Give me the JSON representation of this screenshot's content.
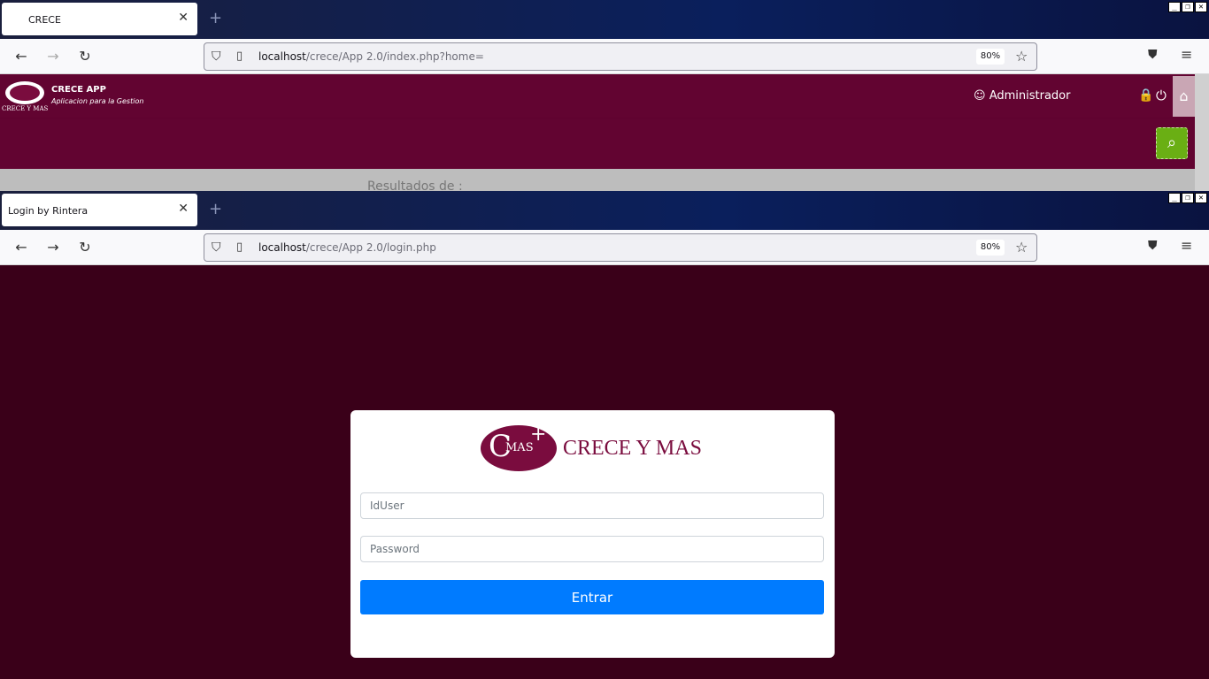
{
  "window1": {
    "tab_title": "CRECE",
    "url_host": "localhost",
    "url_path": "/crece/App 2.0/index.php?home=",
    "zoom": "80%"
  },
  "page1": {
    "app_name": "CRECE APP",
    "app_subtitle": "Aplicacion para la Gestion",
    "logo_text": "CRECE Y MAS",
    "user_label": "Administrador",
    "results_label": "Resultados de :"
  },
  "window2": {
    "tab_title": "Login by Rintera",
    "url_host": "localhost",
    "url_path": "/crece/App 2.0/login.php",
    "zoom": "80%"
  },
  "login": {
    "logo_letter": "C",
    "logo_mas": "MAS",
    "logo_plus": "+",
    "brand": "CRECE Y MAS",
    "user_placeholder": "IdUser",
    "password_placeholder": "Password",
    "submit_label": "Entrar"
  },
  "icons": {
    "back": "arrow-left-icon",
    "forward": "arrow-right-icon",
    "reload": "reload-icon",
    "shield": "shield-icon",
    "page": "page-icon",
    "star": "star-icon",
    "pocket": "pocket-icon",
    "menu": "hamburger-menu-icon",
    "user": "user-icon",
    "lock": "lock-icon",
    "power": "power-icon",
    "home": "home-icon",
    "search": "search-icon"
  },
  "colors": {
    "brand_maroon": "#620431",
    "login_bg": "#3a0019",
    "search_green": "#6aaf14",
    "primary_blue": "#007bff"
  }
}
